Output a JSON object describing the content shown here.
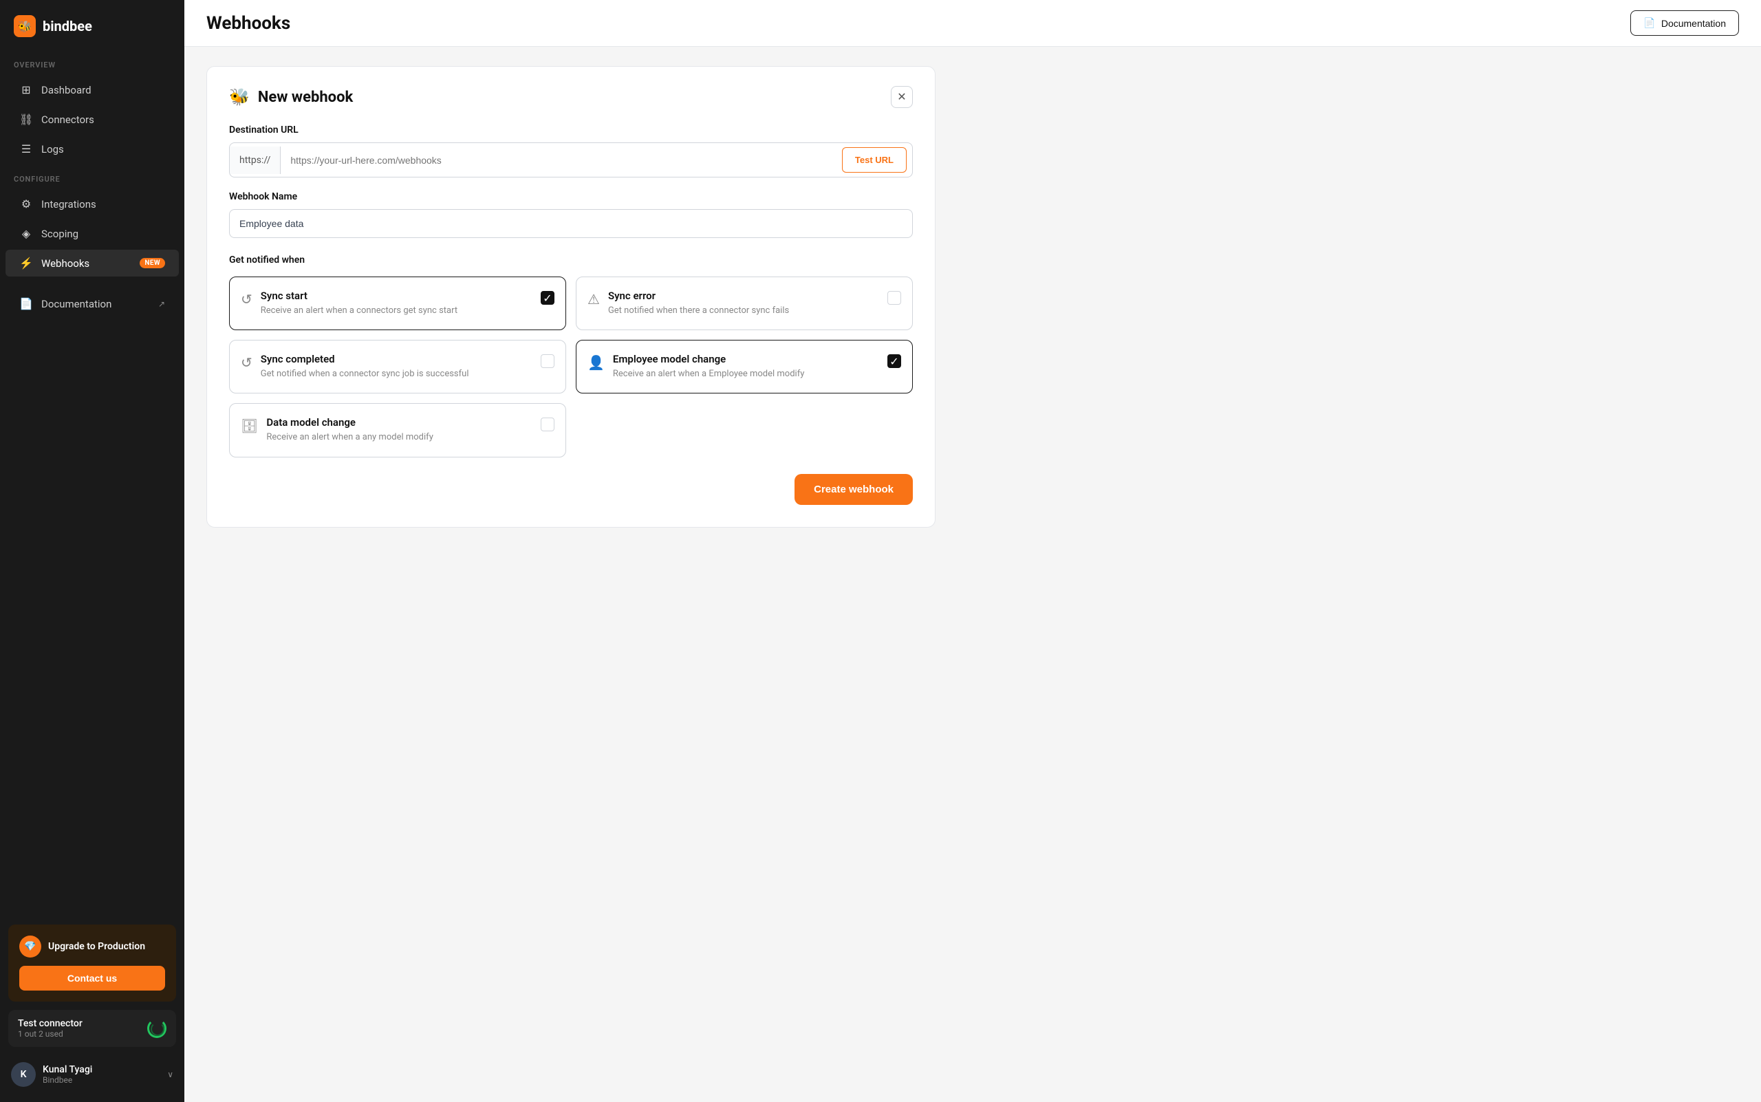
{
  "app": {
    "logo_text": "bindbee",
    "logo_icon": "🐝"
  },
  "sidebar": {
    "overview_label": "OVERVIEW",
    "configure_label": "CONFIGURE",
    "items": [
      {
        "id": "dashboard",
        "label": "Dashboard",
        "icon": "⊞",
        "active": false
      },
      {
        "id": "connectors",
        "label": "Connectors",
        "icon": "🔗",
        "active": false
      },
      {
        "id": "logs",
        "label": "Logs",
        "icon": "☰",
        "active": false
      },
      {
        "id": "integrations",
        "label": "Integrations",
        "icon": "⚙",
        "active": false
      },
      {
        "id": "scoping",
        "label": "Scoping",
        "icon": "◈",
        "active": false
      },
      {
        "id": "webhooks",
        "label": "Webhooks",
        "icon": "🔗",
        "active": true,
        "badge": "NEW"
      }
    ],
    "documentation": {
      "label": "Documentation",
      "icon": "📄",
      "arrow": "↗"
    },
    "upgrade": {
      "title": "Upgrade to Production",
      "icon": "💎",
      "contact_label": "Contact us"
    },
    "connector": {
      "title": "Test connector",
      "subtitle": "1 out 2 used"
    },
    "user": {
      "name": "Kunal Tyagi",
      "company": "Bindbee",
      "avatar": "K"
    }
  },
  "topbar": {
    "title": "Webhooks",
    "doc_btn": "Documentation",
    "doc_icon": "📄"
  },
  "webhook_form": {
    "title": "New webhook",
    "icon": "🐝",
    "destination_url_label": "Destination URL",
    "url_prefix": "https://",
    "url_placeholder": "https://your-url-here.com/webhooks",
    "test_url_label": "Test URL",
    "webhook_name_label": "Webhook Name",
    "webhook_name_value": "Employee data",
    "notify_label": "Get notified when",
    "options": [
      {
        "id": "sync-start",
        "icon": "↺",
        "title": "Sync start",
        "desc": "Receive an alert when a connectors get sync start",
        "checked": true
      },
      {
        "id": "sync-error",
        "icon": "⚠",
        "title": "Sync error",
        "desc": "Get notified when there a connector sync fails",
        "checked": false
      },
      {
        "id": "sync-completed",
        "icon": "↺",
        "title": "Sync completed",
        "desc": "Get notified when a connector sync job is successful",
        "checked": false
      },
      {
        "id": "employee-model-change",
        "icon": "👤",
        "title": "Employee model change",
        "desc": "Receive an alert when a Employee model modify",
        "checked": true
      }
    ],
    "single_option": {
      "id": "data-model-change",
      "icon": "🗄",
      "title": "Data model change",
      "desc": "Receive an alert when a any model modify",
      "checked": false
    },
    "create_btn": "Create webhook",
    "close_icon": "✕"
  }
}
